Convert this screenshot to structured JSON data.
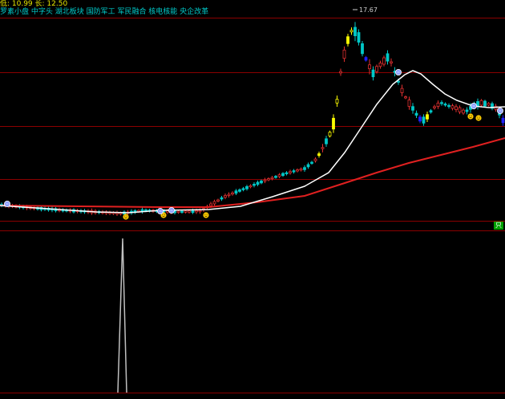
{
  "header": {
    "prices_text": "低: 10.99  长: 12.50",
    "tags_text": "罗素小盘  中字头  湖北板块  国防军工  军民融合  核电核能  央企改革"
  },
  "annotation": {
    "high_label": "17.67"
  },
  "panel_tag": "只",
  "colors": {
    "background": "#000000",
    "grid_line": "#8b0000",
    "up_candle": "#e03030",
    "down_candle": "#00c8c8",
    "special_up": "#ffff00",
    "special_down": "#2020ff",
    "ma_fast": "#ffffff",
    "ma_slow": "#e02020",
    "indicator": "#c0c0c0"
  },
  "icons": [
    "smiley-icon",
    "circle-marker-icon"
  ]
}
